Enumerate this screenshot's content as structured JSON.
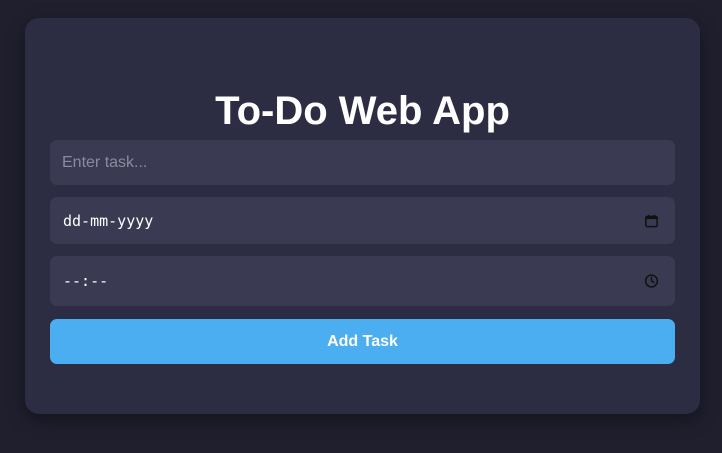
{
  "app": {
    "title": "To-Do Web App"
  },
  "form": {
    "task_placeholder": "Enter task...",
    "task_value": "",
    "date_value": "dd-mm-yyyy",
    "time_value": "--:--",
    "add_button_label": "Add Task"
  },
  "icons": {
    "date": "calendar-icon",
    "time": "clock-icon"
  },
  "colors": {
    "background": "#1f1f2e",
    "card": "#2c2d43",
    "field": "#3a3b53",
    "accent": "#4baef0",
    "text": "#ffffff",
    "placeholder": "#8a8b9c"
  }
}
